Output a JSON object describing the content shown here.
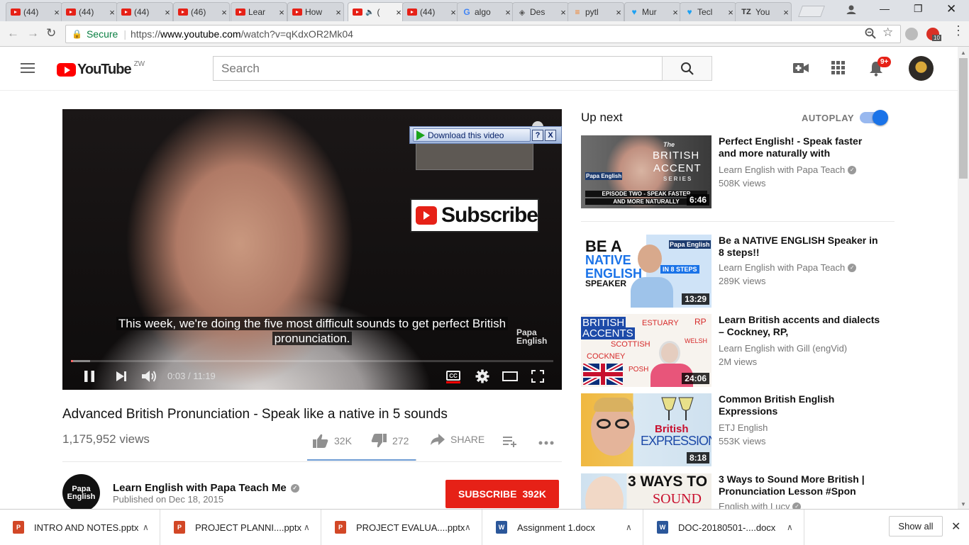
{
  "browser": {
    "tabs": [
      {
        "label": "(44)",
        "icon": "youtube"
      },
      {
        "label": "(44)",
        "icon": "youtube"
      },
      {
        "label": "(44)",
        "icon": "youtube"
      },
      {
        "label": "(46)",
        "icon": "youtube"
      },
      {
        "label": "Lear",
        "icon": "youtube"
      },
      {
        "label": "How",
        "icon": "youtube"
      },
      {
        "label": "(",
        "icon": "youtube",
        "active": true
      },
      {
        "label": "(44)",
        "icon": "youtube"
      },
      {
        "label": "algo",
        "icon": "google"
      },
      {
        "label": "Des",
        "icon": "github-like"
      },
      {
        "label": "pytl",
        "icon": "stackoverflow"
      },
      {
        "label": "Mur",
        "icon": "twitter"
      },
      {
        "label": "Tecl",
        "icon": "twitter"
      },
      {
        "label": "You",
        "icon": "tz"
      }
    ],
    "close_glyph": "×",
    "secure_label": "Secure",
    "url_scheme": "https://",
    "url_host": "www.youtube.com",
    "url_path": "/watch?v=qKdxOR2Mk04",
    "extension_badge": "10"
  },
  "header": {
    "logo_text": "YouTube",
    "country_code": "ZW",
    "search_placeholder": "Search",
    "notification_count": "9+"
  },
  "player": {
    "download_label": "Download this video",
    "download_help": "?",
    "download_close": "X",
    "subscribe_overlay": "Subscribe",
    "caption_line1": "This week, we're doing the five most difficult sounds to get perfect British",
    "caption_line2": "pronunciation.",
    "watermark_line1": "Papa",
    "watermark_line2": "English",
    "time_current": "0:03",
    "time_separator": "/",
    "time_total": "11:19",
    "progress_fraction": 0.0044,
    "cc_label": "CC"
  },
  "video": {
    "title": "Advanced British Pronunciation - Speak like a native in 5 sounds",
    "views": "1,175,952 views",
    "likes": "32K",
    "dislikes": "272",
    "share_label": "SHARE",
    "like_ratio": 0.9916
  },
  "channel": {
    "avatar_line1": "Papa",
    "avatar_line2": "English",
    "name": "Learn English with Papa Teach Me",
    "published": "Published on Dec 18, 2015",
    "subscribe_label": "SUBSCRIBE",
    "subscriber_count": "392K"
  },
  "sidebar": {
    "up_next": "Up next",
    "autoplay": "AUTOPLAY",
    "autoplay_on": true,
    "videos": [
      {
        "title": "Perfect English! - Speak faster and more naturally with",
        "channel": "Learn English with Papa Teach",
        "views": "508K views",
        "duration": "6:46",
        "verified": true,
        "thumb_lines": [
          "The",
          "BRITISH",
          "ACCENT",
          "SERIES",
          "EPISODE TWO - SPEAK FASTER",
          "AND MORE NATURALLY"
        ],
        "thumb_logo": "Papa English"
      },
      {
        "title": "Be a NATIVE ENGLISH Speaker in 8 steps!!",
        "channel": "Learn English with Papa Teach",
        "views": "289K views",
        "duration": "13:29",
        "verified": true,
        "thumb_lines": [
          "BE A",
          "NATIVE",
          "ENGLISH",
          "SPEAKER",
          "IN 8 STEPS"
        ],
        "thumb_logo": "Papa English"
      },
      {
        "title": "Learn British accents and dialects – Cockney, RP,",
        "channel": "Learn English with Gill (engVid)",
        "views": "2M views",
        "duration": "24:06",
        "verified": false,
        "thumb_lines": [
          "BRITISH",
          "ACCENTS",
          "ESTUARY",
          "RP",
          "SCOTTISH",
          "WELSH",
          "COCKNEY",
          "POSH"
        ]
      },
      {
        "title": "Common British English Expressions",
        "channel": "ETJ English",
        "views": "553K views",
        "duration": "8:18",
        "verified": false,
        "thumb_lines": [
          "British",
          "EXPRESSIONS"
        ]
      },
      {
        "title": "3 Ways to Sound More British | Pronunciation Lesson #Spon",
        "channel": "English with Lucy",
        "views": "",
        "duration": "",
        "verified": true,
        "thumb_lines": [
          "3 WAYS TO",
          "SOUND"
        ]
      }
    ]
  },
  "downloads": {
    "items": [
      {
        "name": "INTRO AND NOTES.pptx",
        "type": "ppt"
      },
      {
        "name": "PROJECT PLANNI....pptx",
        "type": "ppt"
      },
      {
        "name": "PROJECT EVALUA....pptx",
        "type": "ppt"
      },
      {
        "name": "Assignment 1.docx",
        "type": "doc"
      },
      {
        "name": "DOC-20180501-....docx",
        "type": "doc"
      }
    ],
    "show_all": "Show all"
  },
  "colors": {
    "youtube_red": "#ff0000",
    "subscribe_red": "#e62117",
    "autoplay_blue": "#1a73e8",
    "secure_green": "#0b8043"
  }
}
